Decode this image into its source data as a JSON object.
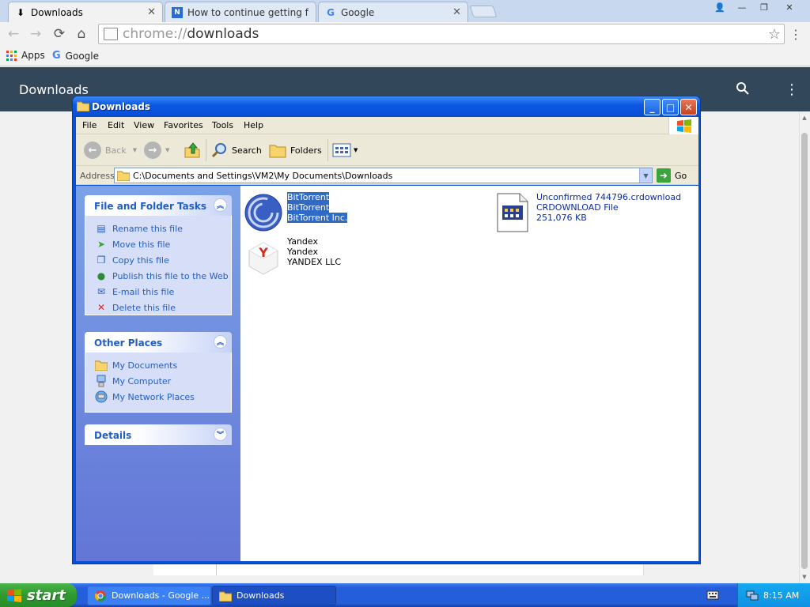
{
  "browser": {
    "tabs": [
      {
        "title": "Downloads",
        "active": true
      },
      {
        "title": "How to continue getting free",
        "active": false
      },
      {
        "title": "Google",
        "active": false
      }
    ],
    "url_scheme": "chrome://",
    "url_path": "downloads",
    "bookmarks": [
      {
        "label": "Apps"
      },
      {
        "label": "Google"
      }
    ]
  },
  "downloads_page": {
    "title": "Downloads"
  },
  "explorer": {
    "title": "Downloads",
    "menu": [
      "File",
      "Edit",
      "View",
      "Favorites",
      "Tools",
      "Help"
    ],
    "toolbar": {
      "back": "Back",
      "search": "Search",
      "folders": "Folders"
    },
    "address_label": "Address",
    "address_path": "C:\\Documents and Settings\\VM2\\My Documents\\Downloads",
    "go_label": "Go",
    "file_tasks": {
      "title": "File and Folder Tasks",
      "items": [
        "Rename this file",
        "Move this file",
        "Copy this file",
        "Publish this file to the Web",
        "E-mail this file",
        "Delete this file"
      ]
    },
    "other_places": {
      "title": "Other Places",
      "items": [
        "My Documents",
        "My Computer",
        "My Network Places"
      ]
    },
    "details": {
      "title": "Details"
    },
    "files": [
      {
        "lines": [
          "BitTorrent",
          "BitTorrent",
          "BitTorrent Inc."
        ],
        "selected": true,
        "icon": "bittorrent-icon"
      },
      {
        "lines": [
          "Unconfirmed 744796.crdownload",
          "CRDOWNLOAD File",
          "251,076 KB"
        ],
        "selected": false,
        "icon": "crdownload-file-icon"
      },
      {
        "lines": [
          "Yandex",
          "Yandex",
          "YANDEX LLC"
        ],
        "selected": false,
        "icon": "yandex-icon"
      }
    ]
  },
  "taskbar": {
    "start": "start",
    "tasks": [
      {
        "label": "Downloads - Google ...",
        "active": false
      },
      {
        "label": "Downloads",
        "active": true
      }
    ],
    "clock": "8:15 AM"
  },
  "colors": {
    "xp_blue": "#0a4fd8",
    "chrome_header": "#33475b",
    "selection": "#316ac5"
  }
}
